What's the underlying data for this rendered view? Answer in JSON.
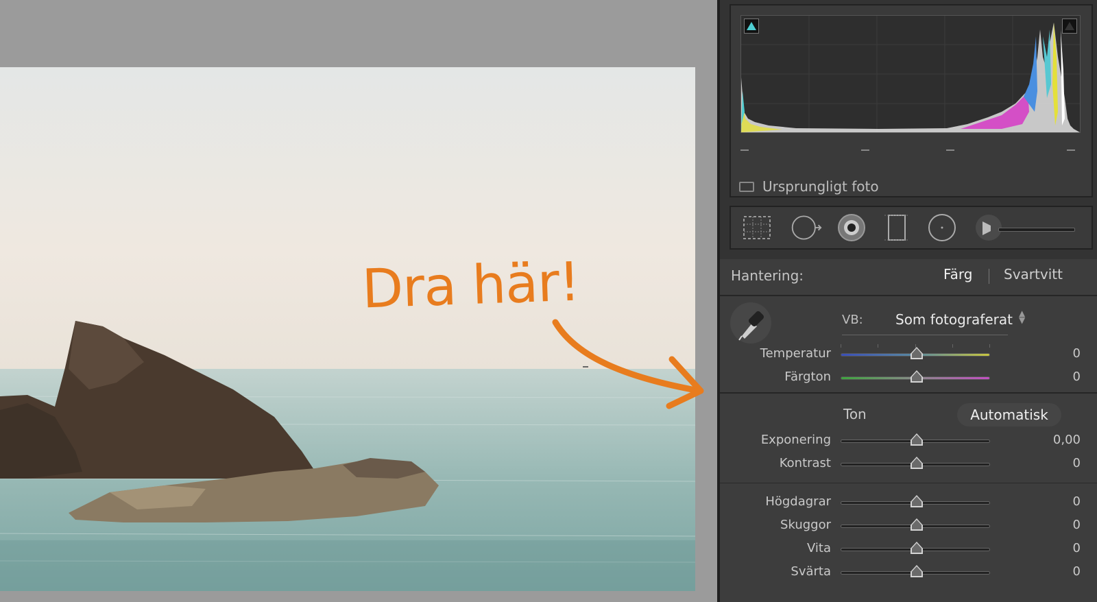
{
  "annotation": {
    "text": "Dra här!",
    "color": "#e87c1e"
  },
  "histogram": {
    "original_photo_label": "Ursprungligt foto"
  },
  "tools": [
    {
      "name": "crop-overlay-icon"
    },
    {
      "name": "spot-removal-icon"
    },
    {
      "name": "red-eye-icon"
    },
    {
      "name": "graduated-filter-icon"
    },
    {
      "name": "radial-filter-icon"
    },
    {
      "name": "adjustment-brush-icon"
    }
  ],
  "treatment": {
    "label": "Hantering:",
    "color": "Färg",
    "bw": "Svartvitt"
  },
  "white_balance": {
    "label": "VB:",
    "value": "Som fotograferat",
    "sliders": [
      {
        "label": "Temperatur",
        "value": "0",
        "position": 0.5
      },
      {
        "label": "Färgton",
        "value": "0",
        "position": 0.5
      }
    ]
  },
  "tone": {
    "label": "Ton",
    "auto_label": "Automatisk",
    "sliders": [
      {
        "label": "Exponering",
        "value": "0,00",
        "position": 0.5
      },
      {
        "label": "Kontrast",
        "value": "0",
        "position": 0.5
      },
      {
        "label": "Högdagrar",
        "value": "0",
        "position": 0.5
      },
      {
        "label": "Skuggor",
        "value": "0",
        "position": 0.5
      },
      {
        "label": "Vita",
        "value": "0",
        "position": 0.5
      },
      {
        "label": "Svärta",
        "value": "0",
        "position": 0.5
      }
    ]
  }
}
